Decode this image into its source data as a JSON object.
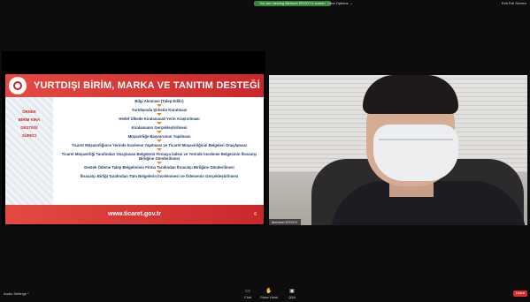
{
  "top_bar": {
    "share_notice": "You are viewing Mehmet ERSOY's screen",
    "view_options": "View Options",
    "exit": "Exit Full Screen"
  },
  "slide": {
    "title": "YURTDIŞI BİRİM, MARKA VE TANITIM DESTEĞİ",
    "left_labels": [
      "ÖRNEK",
      "BİRİM KİRA",
      "DESTEĞİ",
      "SÜRECİ"
    ],
    "steps": [
      "Bilgi Alınması (Talep Edilir)",
      "Yurtdışında Şirketin Kurulması",
      "Hedef Ülkede Kiralanacak Yerin Araştırılması",
      "Kiralamanın Gerçekleştirilmesi",
      "Müşavirliğe Başvurunun Yapılması",
      "Ticaret Müşavirliğince Yerinde İnceleme Yapılması ve Ticaret Müşavirliğinin Belgeleri Onaylaması",
      "Ticaret Müşavirliği Tarafından Onaylanan Belgelerin Firmaya İadesi ve Yerinde İnceleme Belgesinin İhracatçı Birliğine Gönderilmesi",
      "Destek Ödeme Talep Belgelerinin Firma Tarafından İhracatçı Birliğine Gönderilmesi",
      "İhracatçı Birliği Tarafından Tüm Belgelerin İncelenmesi ve Ödemenin Gerçekleştirilmesi"
    ],
    "footer_url": "www.ticaret.gov.tr",
    "page_number": "6"
  },
  "video": {
    "name_tag": "Mehmet ERSOY"
  },
  "bottom_bar": {
    "audio_settings": "Audio Settings ^",
    "controls": [
      {
        "label": "Chat",
        "icon": "chat-icon"
      },
      {
        "label": "Raise Hand",
        "icon": "raise-hand-icon"
      },
      {
        "label": "Q&A",
        "icon": "qa-icon"
      }
    ],
    "leave": "Leave"
  },
  "colors": {
    "accent_red": "#c9282a",
    "share_green": "#2e8b3a",
    "step_text": "#1f3c6e",
    "arrow_orange": "#e8872e"
  }
}
